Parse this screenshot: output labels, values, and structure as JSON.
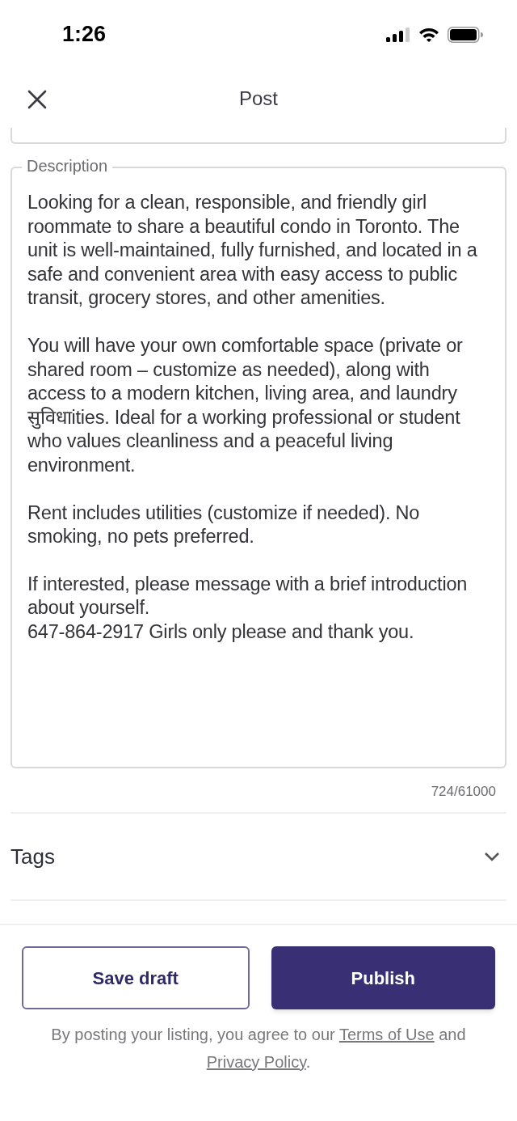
{
  "status_bar": {
    "time": "1:26"
  },
  "header": {
    "title": "Post"
  },
  "description": {
    "label": "Description",
    "paragraphs": [
      "Looking for a clean, responsible, and friendly girl roommate to share a beautiful condo in Toronto. The unit is well-maintained, fully furnished, and located in a safe and convenient area with easy access to public transit, grocery stores, and other amenities.",
      "You will have your own comfortable space (private or shared room – customize as needed), along with access to a modern kitchen, living area, and laundry सुविधाities. Ideal for a working professional or student who values cleanliness and a peaceful living environment.",
      "Rent includes utilities (customize if needed). No smoking, no pets preferred.",
      "If interested, please message with a brief introduction about yourself.\n647-864-2917 Girls only please and thank you."
    ],
    "counter": "724/61000"
  },
  "tags": {
    "label": "Tags",
    "expanded": false
  },
  "buttons": [
    {
      "label": "Save draft",
      "kind": "secondary"
    },
    {
      "label": "Publish",
      "kind": "primary"
    }
  ],
  "legal": {
    "before": "By posting your listing, you agree to our ",
    "link_1": "Terms of Use",
    "middle": " and ",
    "link_2": "Privacy Policy",
    "after": "."
  }
}
